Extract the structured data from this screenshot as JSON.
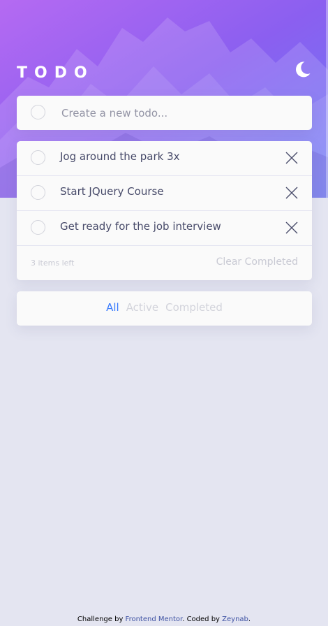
{
  "app": {
    "title": "TODO",
    "theme_toggle_icon": "moon-icon"
  },
  "colors": {
    "hero_gradient_start": "#a865f0",
    "hero_gradient_end": "#6a78f5",
    "page_background": "#e4e5f1",
    "card_background": "#fafafa",
    "active_filter": "#3a7bfd",
    "text_primary": "#484b6a",
    "text_muted": "#c8c9d3"
  },
  "new_todo": {
    "placeholder": "Create a new todo...",
    "value": ""
  },
  "todos": [
    {
      "text": "Jog around the park 3x",
      "completed": false,
      "delete_icon": "close-icon"
    },
    {
      "text": "Start JQuery Course",
      "completed": false,
      "delete_icon": "close-icon"
    },
    {
      "text": "Get ready for the job interview",
      "completed": false,
      "delete_icon": "close-icon"
    }
  ],
  "list_footer": {
    "items_left": "3 items left",
    "clear_completed": "Clear Completed"
  },
  "filters": {
    "all": "All",
    "active": "Active",
    "completed": "Completed",
    "selected": "All"
  },
  "attribution": {
    "prefix": "Challenge by ",
    "link1": "Frontend Mentor",
    "middle": ". Coded by ",
    "link2": "Zeynab",
    "suffix": "."
  }
}
